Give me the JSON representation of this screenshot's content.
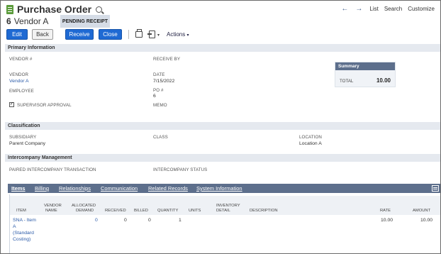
{
  "header": {
    "title": "Purchase Order",
    "record_number": "6",
    "record_name": "Vendor A",
    "status": "PENDING RECEIPT"
  },
  "topnav": {
    "back_arrow": "←",
    "forward_arrow": "→",
    "list": "List",
    "search": "Search",
    "customize": "Customize"
  },
  "toolbar": {
    "edit": "Edit",
    "back": "Back",
    "receive": "Receive",
    "close": "Close",
    "actions": "Actions",
    "caret": "▾"
  },
  "primary": {
    "section_title": "Primary Information",
    "vendor_no_label": "VENDOR #",
    "vendor_label": "VENDOR",
    "vendor_value": "Vendor A",
    "employee_label": "EMPLOYEE",
    "supervisor_label": "SUPERVISOR APPROVAL",
    "supervisor_checked": true,
    "receive_by_label": "RECEIVE BY",
    "date_label": "DATE",
    "date_value": "7/15/2022",
    "po_label": "PO #",
    "po_value": "6",
    "memo_label": "MEMO"
  },
  "summary": {
    "title": "Summary",
    "total_label": "TOTAL",
    "total_value": "10.00"
  },
  "classification": {
    "section_title": "Classification",
    "subsidiary_label": "SUBSIDIARY",
    "subsidiary_value": "Parent Company",
    "class_label": "CLASS",
    "location_label": "LOCATION",
    "location_value": "Location A"
  },
  "intercompany": {
    "section_title": "Intercompany Management",
    "paired_label": "PAIRED INTERCOMPANY TRANSACTION",
    "status_label": "INTERCOMPANY STATUS"
  },
  "tabs": [
    {
      "label": "Items",
      "active": true
    },
    {
      "label": "Billing"
    },
    {
      "label": "Relationships"
    },
    {
      "label": "Communication"
    },
    {
      "label": "Related Records"
    },
    {
      "label": "System Information"
    }
  ],
  "items_table": {
    "columns": {
      "item": "ITEM",
      "vendor_name_1": "VENDOR",
      "vendor_name_2": "NAME",
      "allocated_1": "ALLOCATED",
      "allocated_2": "DEMAND",
      "received": "RECEIVED",
      "billed": "BILLED",
      "quantity": "QUANTITY",
      "units": "UNITS",
      "inventory_1": "INVENTORY",
      "inventory_2": "DETAIL",
      "description": "DESCRIPTION",
      "rate": "RATE",
      "amount": "AMOUNT"
    },
    "row": {
      "item_line1": "SNA - Item",
      "item_line2": "A",
      "item_line3": "(Standard",
      "item_line4": "Costing)",
      "allocated": "0",
      "received": "0",
      "billed": "0",
      "quantity": "1",
      "rate": "10.00",
      "amount": "10.00"
    }
  },
  "colors": {
    "primary_button": "#1f6ad3",
    "tab_bar": "#5d6f8c",
    "section_band": "#e5e9ef",
    "link": "#2a5aa8",
    "brand_icon": "#5b9b3b"
  }
}
